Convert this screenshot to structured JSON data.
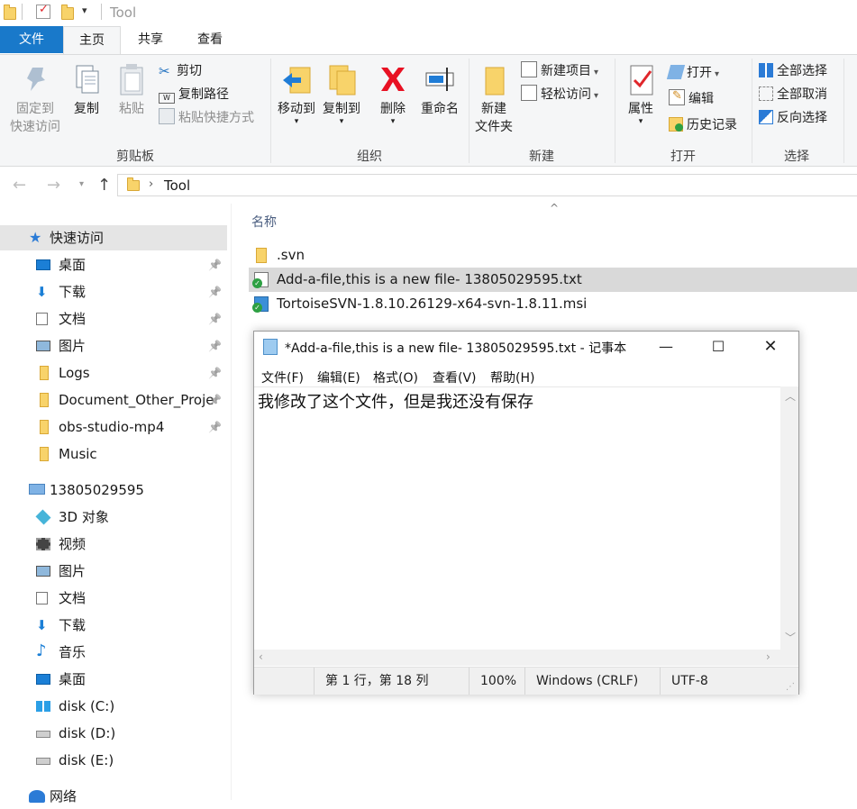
{
  "window": {
    "title": "Tool"
  },
  "tabs": [
    {
      "label": "文件",
      "active": false
    },
    {
      "label": "主页",
      "active": true
    },
    {
      "label": "共享",
      "active": false
    },
    {
      "label": "查看",
      "active": false
    }
  ],
  "ribbon": {
    "clipboard": {
      "label": "剪贴板",
      "pin": {
        "line1": "固定到",
        "line2": "快速访问"
      },
      "copy": "复制",
      "paste": "粘贴",
      "cut": "剪切",
      "copy_path": "复制路径",
      "paste_shortcut": "粘贴快捷方式"
    },
    "organize": {
      "label": "组织",
      "move_to": "移动到",
      "copy_to": "复制到",
      "delete": "删除",
      "rename": "重命名"
    },
    "new": {
      "label": "新建",
      "new_folder": {
        "line1": "新建",
        "line2": "文件夹"
      },
      "new_item": "新建项目",
      "easy_access": "轻松访问"
    },
    "open": {
      "label": "打开",
      "properties": "属性",
      "open": "打开",
      "edit": "编辑",
      "history": "历史记录"
    },
    "select": {
      "label": "选择",
      "select_all": "全部选择",
      "select_none": "全部取消",
      "invert": "反向选择"
    }
  },
  "address": {
    "path": [
      "Tool"
    ]
  },
  "sidebar": {
    "quick_access": "快速访问",
    "quick_items": [
      {
        "label": "桌面",
        "icon": "desktop-icon",
        "pinned": true
      },
      {
        "label": "下载",
        "icon": "download-icon",
        "pinned": true
      },
      {
        "label": "文档",
        "icon": "document-icon",
        "pinned": true
      },
      {
        "label": "图片",
        "icon": "pictures-icon",
        "pinned": true
      },
      {
        "label": "Logs",
        "icon": "folder-icon",
        "pinned": true
      },
      {
        "label": "Document_Other_Proje",
        "icon": "folder-icon",
        "pinned": true
      },
      {
        "label": "obs-studio-mp4",
        "icon": "folder-icon",
        "pinned": true
      },
      {
        "label": "Music",
        "icon": "folder-icon",
        "pinned": false
      }
    ],
    "this_pc": "13805029595",
    "pc_items": [
      {
        "label": "3D 对象",
        "icon": "3d-objects-icon"
      },
      {
        "label": "视频",
        "icon": "video-icon"
      },
      {
        "label": "图片",
        "icon": "pictures-icon"
      },
      {
        "label": "文档",
        "icon": "document-icon"
      },
      {
        "label": "下载",
        "icon": "download-icon"
      },
      {
        "label": "音乐",
        "icon": "music-icon"
      },
      {
        "label": "桌面",
        "icon": "desktop-icon"
      },
      {
        "label": "disk (C:)",
        "icon": "windows-drive-icon"
      },
      {
        "label": "disk (D:)",
        "icon": "drive-icon"
      },
      {
        "label": "disk (E:)",
        "icon": "drive-icon"
      }
    ],
    "network": "网络"
  },
  "file_list": {
    "column_name": "名称",
    "files": [
      {
        "name": ".svn",
        "icon": "folder-icon",
        "selected": false
      },
      {
        "name": "Add-a-file,this is a new file- 13805029595.txt",
        "icon": "svn-text-file-icon",
        "selected": true
      },
      {
        "name": "TortoiseSVN-1.8.10.26129-x64-svn-1.8.11.msi",
        "icon": "svn-installer-icon",
        "selected": false
      }
    ]
  },
  "notepad": {
    "title": "*Add-a-file,this is a new file- 13805029595.txt - 记事本",
    "menu": [
      "文件(F)",
      "编辑(E)",
      "格式(O)",
      "查看(V)",
      "帮助(H)"
    ],
    "content": "我修改了这个文件，但是我还没有保存",
    "status": {
      "position": "第 1 行，第 18 列",
      "zoom": "100%",
      "line_ending": "Windows (CRLF)",
      "encoding": "UTF-8"
    }
  },
  "colors": {
    "file_tab": "#1979ca",
    "selection": "#d9d9d9",
    "quick_access_star": "#2b7bd6",
    "delete_red": "#e81123",
    "svn_green": "#2ea043"
  }
}
